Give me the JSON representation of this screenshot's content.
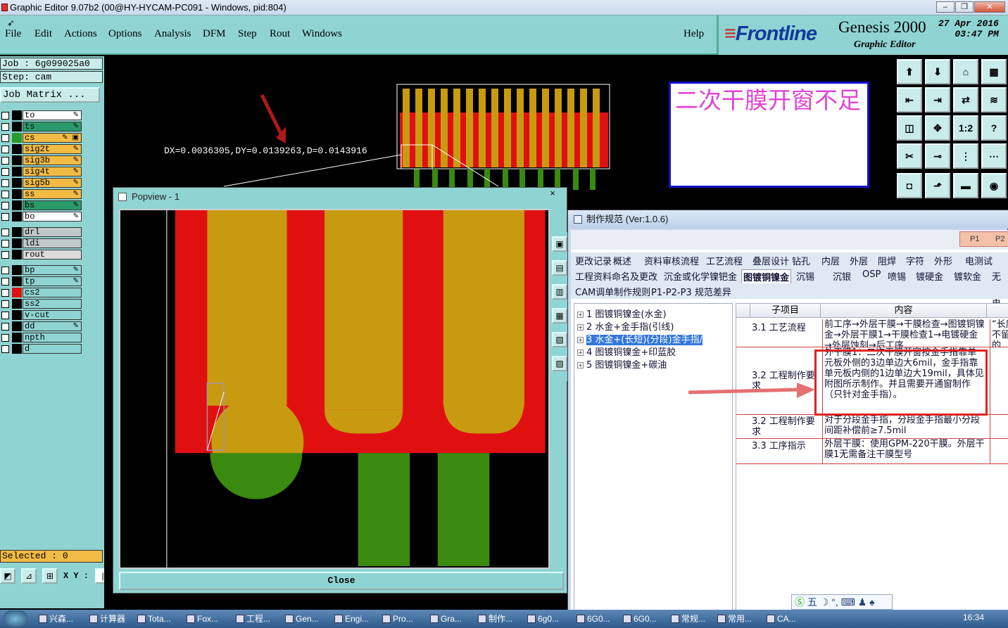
{
  "window": {
    "title": "Graphic Editor 9.07b2 (00@HY-HYCAM-PC091 - Windows, pid:804)"
  },
  "menu": [
    "File",
    "Edit",
    "Actions",
    "Options",
    "Analysis",
    "DFM",
    "Step",
    "Rout",
    "Windows"
  ],
  "help": "Help",
  "brand": {
    "logo": "Frontline",
    "product": "Genesis 2000",
    "subtitle": "Graphic Editor",
    "date": "27 Apr 2016",
    "time": "03:47 PM"
  },
  "job": {
    "job": "Job : 6g099025a0",
    "step": "Step: cam",
    "matrix": "Job Matrix ...",
    "selected": "Selected : 0",
    "xy": "X Y :"
  },
  "layers": [
    {
      "name": "to",
      "color": "#ffffff",
      "swatch": "#000000",
      "mark": "✎"
    },
    {
      "name": "ts",
      "color": "#2a9a6a",
      "swatch": "#000000",
      "mark": "✎"
    },
    {
      "name": "cs",
      "color": "#f2bb44",
      "swatch": "#2a9a2a",
      "mark": "✎ ▣"
    },
    {
      "name": "sig2t",
      "color": "#f2bb44",
      "swatch": "#000000",
      "mark": "✎"
    },
    {
      "name": "sig3b",
      "color": "#f2bb44",
      "swatch": "#000000",
      "mark": "✎"
    },
    {
      "name": "sig4t",
      "color": "#f2bb44",
      "swatch": "#000000",
      "mark": "✎"
    },
    {
      "name": "sig5b",
      "color": "#f2bb44",
      "swatch": "#000000",
      "mark": "✎"
    },
    {
      "name": "ss",
      "color": "#f2bb44",
      "swatch": "#000000",
      "mark": "✎"
    },
    {
      "name": "bs",
      "color": "#2a9a6a",
      "swatch": "#000000",
      "mark": "✎"
    },
    {
      "name": "bo",
      "color": "#ffffff",
      "swatch": "#000000",
      "mark": "✎"
    },
    {
      "name": "drl",
      "color": "#bfc9c9",
      "swatch": "#000000",
      "mark": ""
    },
    {
      "name": "ldi",
      "color": "#bfc9c9",
      "swatch": "#000000",
      "mark": ""
    },
    {
      "name": "rout",
      "color": "#dcdcdc",
      "swatch": "#000000",
      "mark": ""
    },
    {
      "name": "bp",
      "color": "#8fd4d2",
      "swatch": "#000000",
      "mark": "✎"
    },
    {
      "name": "tp",
      "color": "#8fd4d2",
      "swatch": "#000000",
      "mark": "✎"
    },
    {
      "name": "cs2",
      "color": "#8fd4d2",
      "swatch": "#dd1111",
      "mark": ""
    },
    {
      "name": "ss2",
      "color": "#8fd4d2",
      "swatch": "#000000",
      "mark": ""
    },
    {
      "name": "v-cut",
      "color": "#8fd4d2",
      "swatch": "#000000",
      "mark": ""
    },
    {
      "name": "dd",
      "color": "#8fd4d2",
      "swatch": "#000000",
      "mark": "✎"
    },
    {
      "name": "npth",
      "color": "#8fd4d2",
      "swatch": "#000000",
      "mark": ""
    },
    {
      "name": "d",
      "color": "#8fd4d2",
      "swatch": "#000000",
      "mark": ""
    }
  ],
  "canvas": {
    "measure": "DX=0.0036305,DY=0.0139263,D=0.0143916"
  },
  "note": {
    "text": "二次干膜开窗不足"
  },
  "popview": {
    "title": "Popview - 1",
    "close_x": "×",
    "close": "Close"
  },
  "toolbox": [
    "⬆",
    "⬇",
    "⌂",
    "▦",
    "⇤",
    "⇥",
    "⇄",
    "≋",
    "◫",
    "✥",
    "1:2",
    "?",
    "✂",
    "⊸",
    "⋮",
    "⋯"
  ],
  "spec": {
    "title": "制作规范 (Ver:1.0.6)",
    "chips": [
      "P1",
      "P2"
    ],
    "tabs1": [
      "更改记录",
      "概述",
      "资料审核流程",
      "工艺流程",
      "叠层设计",
      "钻孔",
      "内层",
      "外层",
      "阻焊",
      "字符",
      "外形",
      "电测试"
    ],
    "tabs2": [
      "工程资料命名及更改",
      "沉金或化学镍钯金",
      "图镀铜镍金",
      "沉锡",
      "沉银",
      "OSP",
      "喷锡",
      "镀硬金",
      "镀软金",
      "无镍电"
    ],
    "tabs3": [
      "CAM调单制作规则",
      "P1-P2-P3 规范差异"
    ],
    "tree": [
      {
        "label": "1  图镀铜镍金(水金)",
        "sel": false
      },
      {
        "label": "2  水金+金手指(引线)",
        "sel": false
      },
      {
        "label": "3  水金+(长短)(分段)金手指/",
        "sel": true
      },
      {
        "label": "4  图镀铜镍金+印蓝胶",
        "sel": false
      },
      {
        "label": "5  图镀铜镍金+碳油",
        "sel": false
      }
    ],
    "headers": {
      "sub": "子项目",
      "content": "内容"
    },
    "rows": [
      {
        "sub": "3.1 工艺流程",
        "content": "前工序→外层干膜→干膜检查→图镀铜镍金→外层干膜1→干膜检查1→电镀硬金→外层蚀刻→后工序",
        "ext": "“长度不留的"
      },
      {
        "sub": "3.2 工程制作要求",
        "content": "外干膜1：二次干膜开窗按金手指靠单元板外侧的3边单边大6mil，金手指靠单元板内侧的1边单边大19mil，具体见附图所示制作。并且需要开通窗制作（只针对金手指）。",
        "ext": ""
      },
      {
        "sub": "3.2 工程制作要求",
        "content": "对于分段金手指，分段金手指最小分段间距补偿前≥7.5mil",
        "ext": ""
      },
      {
        "sub": "3.3 工序指示",
        "content": "外层干膜：使用GPM-220干膜。外层干膜1无需备注干膜型号",
        "ext": ""
      }
    ]
  },
  "ime": "五 ☽ °, ⌨ ♟ ♠",
  "taskbar": {
    "items": [
      "兴森...",
      "计算器",
      "Tota...",
      "Fox...",
      "工程...",
      "Gen...",
      "Engi...",
      "Pro...",
      "Gra...",
      "制作...",
      "6g0...",
      "6G0...",
      "6G0...",
      "常规...",
      "常用...",
      "CA..."
    ],
    "clock": "16:34"
  }
}
